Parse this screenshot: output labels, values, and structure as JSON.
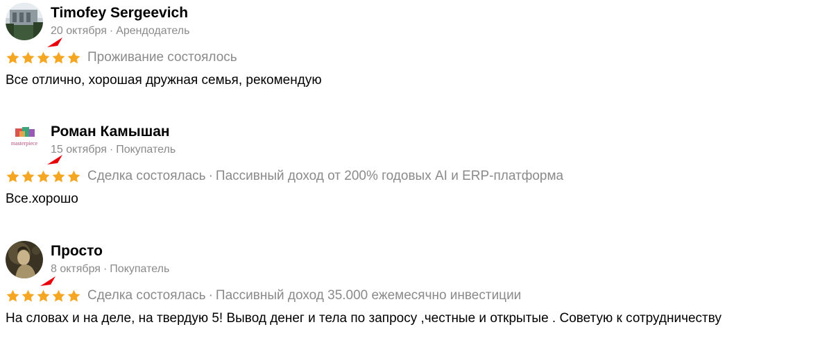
{
  "colors": {
    "star": "#f5a623",
    "muted": "#8a8a8a",
    "marker": "#e8000b"
  },
  "reviews": [
    {
      "avatar_icon": "photo-avatar-icon",
      "author": "Timofey Sergeevich",
      "date": "20 октября",
      "role": "Арендодатель",
      "rating": 5,
      "status": "Проживание состоялось",
      "item": "",
      "text": "Все отлично, хорошая дружная семья, рекомендую"
    },
    {
      "avatar_icon": "masterpiece-logo-icon",
      "avatar_logo_text": "masterpiece",
      "author": "Роман Камышан",
      "date": "15 октября",
      "role": "Покупатель",
      "rating": 5,
      "status": "Сделка состоялась",
      "item": "Пассивный доход от 200% годовых AI и ERP-платформа",
      "text": "Все.хорошо"
    },
    {
      "avatar_icon": "painting-avatar-icon",
      "author": "Просто",
      "date": "8 октября",
      "role": "Покупатель",
      "rating": 5,
      "status": "Сделка состоялась",
      "item": "Пассивный доход 35.000 ежемесячно инвестиции",
      "text": "На словах и на деле, на твердую 5! Вывод денег и тела по запросу ,честные и открытые . Советую к сотрудничеству"
    }
  ],
  "separator": "·"
}
